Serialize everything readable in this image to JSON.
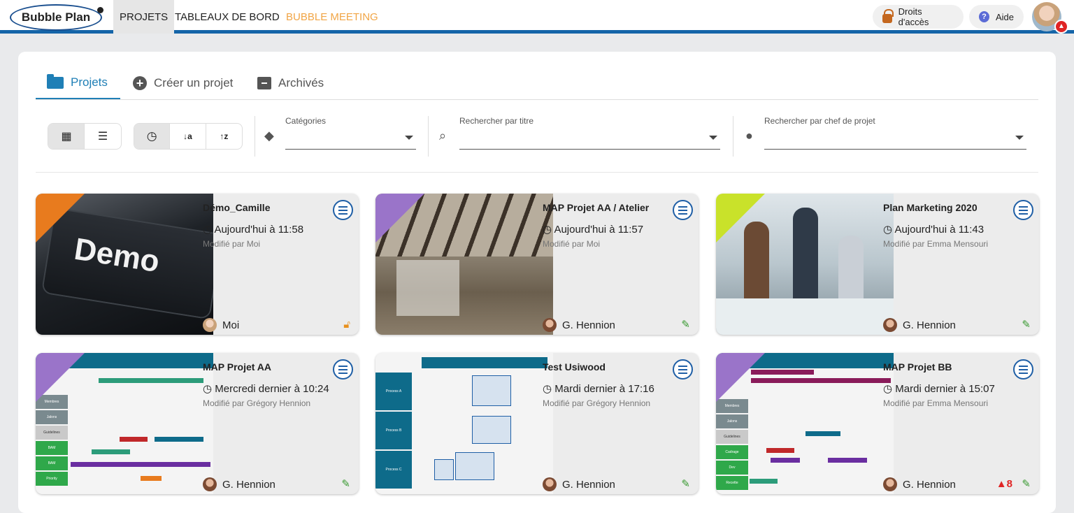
{
  "app": {
    "logo": "Bubble Plan"
  },
  "nav": {
    "projets": "PROJETS",
    "tableaux": "TABLEAUX DE BORD",
    "meeting": "BUBBLE MEETING"
  },
  "header": {
    "droits": "Droits d'accès",
    "aide": "Aide"
  },
  "tabs": {
    "projets": "Projets",
    "creer": "Créer un projet",
    "archives": "Archivés"
  },
  "filters": {
    "categories": "Catégories",
    "titre": "Rechercher par titre",
    "chef": "Rechercher par chef de projet"
  },
  "colors": {
    "accent": "#1f7fb6",
    "orange": "#e87b1e",
    "purple": "#9a74c9",
    "lime": "#c9e22a",
    "green": "#3a9a32",
    "red": "#e02424"
  },
  "cards": [
    {
      "title": "Démo_Camille",
      "date": "Aujourd'hui à 11:58",
      "modified": "Modifié par Moi",
      "owner": "Moi",
      "status": "unlock",
      "thumb": "Demo"
    },
    {
      "title": "MAP Projet AA / Atelier",
      "date": "Aujourd'hui à 11:57",
      "modified": "Modifié par Moi",
      "owner": "G. Hennion",
      "status": "edit"
    },
    {
      "title": "Plan Marketing 2020",
      "date": "Aujourd'hui à 11:43",
      "modified": "Modifié par Emma Mensouri",
      "owner": "G. Hennion",
      "status": "edit"
    },
    {
      "title": "MAP Projet AA",
      "date": "Mercredi dernier à 10:24",
      "modified": "Modifié par Grégory Hennion",
      "owner": "G. Hennion",
      "status": "edit"
    },
    {
      "title": "Test Usiwood",
      "date": "Mardi dernier à 17:16",
      "modified": "Modifié par Grégory Hennion",
      "owner": "G. Hennion",
      "status": "edit"
    },
    {
      "title": "MAP Projet BB",
      "date": "Mardi dernier à 15:07",
      "modified": "Modifié par Emma Mensouri",
      "owner": "G. Hennion",
      "status": "edit",
      "alerts": "8"
    }
  ]
}
